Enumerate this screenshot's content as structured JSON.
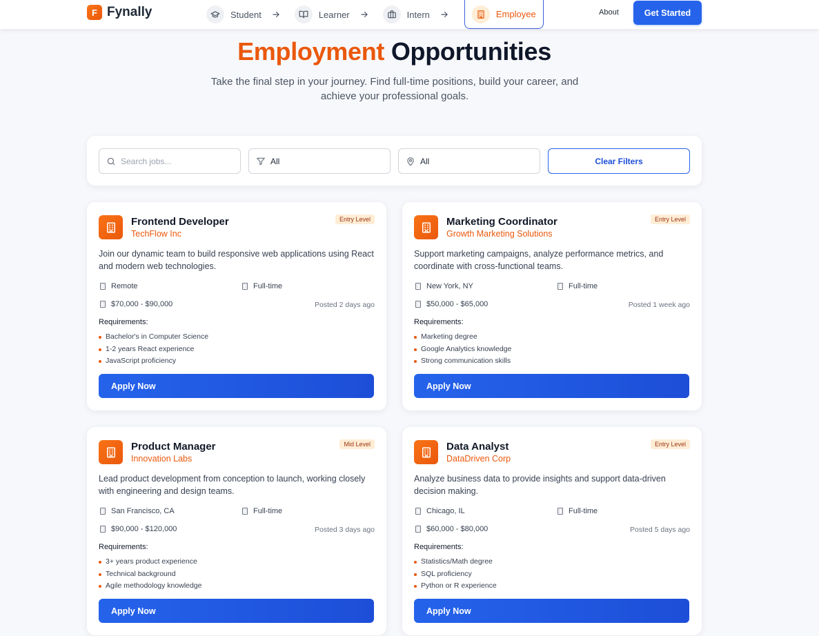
{
  "brand": {
    "mark": "F",
    "name": "Fynally"
  },
  "nav": {
    "steps": [
      {
        "label": "Student",
        "icon": "graduation-cap-icon"
      },
      {
        "label": "Learner",
        "icon": "book-open-icon"
      },
      {
        "label": "Intern",
        "icon": "briefcase-icon"
      },
      {
        "label": "Employee",
        "icon": "building-icon",
        "active": true
      }
    ],
    "about": "About",
    "cta": "Get Started"
  },
  "hero": {
    "title_accent": "Employment",
    "title_rest": " Opportunities",
    "subtitle": "Take the final step in your journey. Find full-time positions, build your career, and achieve your professional goals."
  },
  "filters": {
    "search_placeholder": "Search jobs...",
    "type_value": "All",
    "location_value": "All",
    "clear_label": "Clear Filters"
  },
  "requirements_label": "Requirements:",
  "apply_label": "Apply Now",
  "jobs": [
    {
      "title": "Frontend Developer",
      "company": "TechFlow Inc",
      "level": "Entry Level",
      "description": "Join our dynamic team to build responsive web applications using React and modern web technologies.",
      "location": "Remote",
      "type": "Full-time",
      "salary": "$70,000 - $90,000",
      "posted": "Posted 2 days ago",
      "requirements": [
        "Bachelor's in Computer Science",
        "1-2 years React experience",
        "JavaScript proficiency"
      ]
    },
    {
      "title": "Marketing Coordinator",
      "company": "Growth Marketing Solutions",
      "level": "Entry Level",
      "description": "Support marketing campaigns, analyze performance metrics, and coordinate with cross-functional teams.",
      "location": "New York, NY",
      "type": "Full-time",
      "salary": "$50,000 - $65,000",
      "posted": "Posted 1 week ago",
      "requirements": [
        "Marketing degree",
        "Google Analytics knowledge",
        "Strong communication skills"
      ]
    },
    {
      "title": "Product Manager",
      "company": "Innovation Labs",
      "level": "Mid Level",
      "description": "Lead product development from conception to launch, working closely with engineering and design teams.",
      "location": "San Francisco, CA",
      "type": "Full-time",
      "salary": "$90,000 - $120,000",
      "posted": "Posted 3 days ago",
      "requirements": [
        "3+ years product experience",
        "Technical background",
        "Agile methodology knowledge"
      ]
    },
    {
      "title": "Data Analyst",
      "company": "DataDriven Corp",
      "level": "Entry Level",
      "description": "Analyze business data to provide insights and support data-driven decision making.",
      "location": "Chicago, IL",
      "type": "Full-time",
      "salary": "$60,000 - $80,000",
      "posted": "Posted 5 days ago",
      "requirements": [
        "Statistics/Math degree",
        "SQL proficiency",
        "Python or R experience"
      ]
    }
  ]
}
